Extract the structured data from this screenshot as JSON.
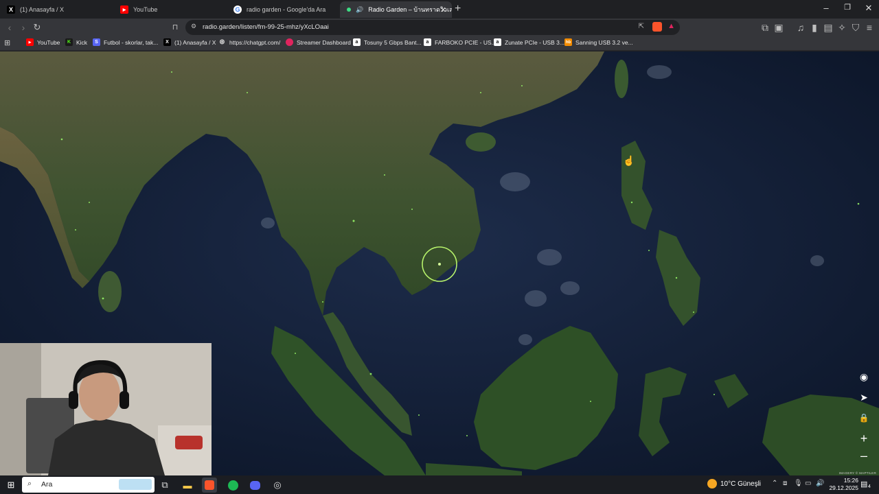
{
  "tabs": [
    {
      "title": "(1) Anasayfa / X",
      "icon": "x-logo-icon"
    },
    {
      "title": "YouTube",
      "icon": "youtube-icon"
    },
    {
      "title": "radio garden - Google'da Ara",
      "icon": "google-icon"
    },
    {
      "title": "Radio Garden – บ้านทราดวิวเลย",
      "icon": "speaker-icon",
      "active": true
    }
  ],
  "address_bar": {
    "url": "radio.garden/listen/fm-99-25-mhz/yXcLOaai"
  },
  "bookmarks": [
    {
      "label": "YouTube",
      "icon": "youtube-icon",
      "color": "#ff0000"
    },
    {
      "label": "Kick",
      "icon": "kick-icon",
      "color": "#53fc18"
    },
    {
      "label": "Futbol - skorlar, tak...",
      "icon": "futbol-icon",
      "color": "#5865f2"
    },
    {
      "label": "(1) Anasayfa / X",
      "icon": "x-logo-icon",
      "color": "#000000"
    },
    {
      "label": "https://chatgpt.com/",
      "icon": "chatgpt-icon",
      "color": "#555555"
    },
    {
      "label": "Streamer Dashboard",
      "icon": "streamer-icon",
      "color": "#e0245e"
    },
    {
      "label": "Tosuny 5 Gbps Bant...",
      "icon": "amazon-icon",
      "color": "#232f3e"
    },
    {
      "label": "FARBOKO PCIE - US...",
      "icon": "amazon-icon",
      "color": "#232f3e"
    },
    {
      "label": "Zunate PCIe - USB 3...",
      "icon": "amazon-icon",
      "color": "#232f3e"
    },
    {
      "label": "Sanning USB 3.2 ve...",
      "icon": "hb-icon",
      "color": "#f28b00"
    }
  ],
  "map": {
    "attribution": "IMAGERY © MAPTILER",
    "controls": [
      "globe-icon",
      "locate-arrow-icon",
      "lock-icon",
      "zoom-in-icon",
      "zoom-out-icon"
    ],
    "selected_station_color": "#b7f36b"
  },
  "taskbar": {
    "search_placeholder": "Ara",
    "weather": "10°C  Güneşli",
    "time": "15:26",
    "date": "29.12.2025",
    "notifications": "4"
  }
}
